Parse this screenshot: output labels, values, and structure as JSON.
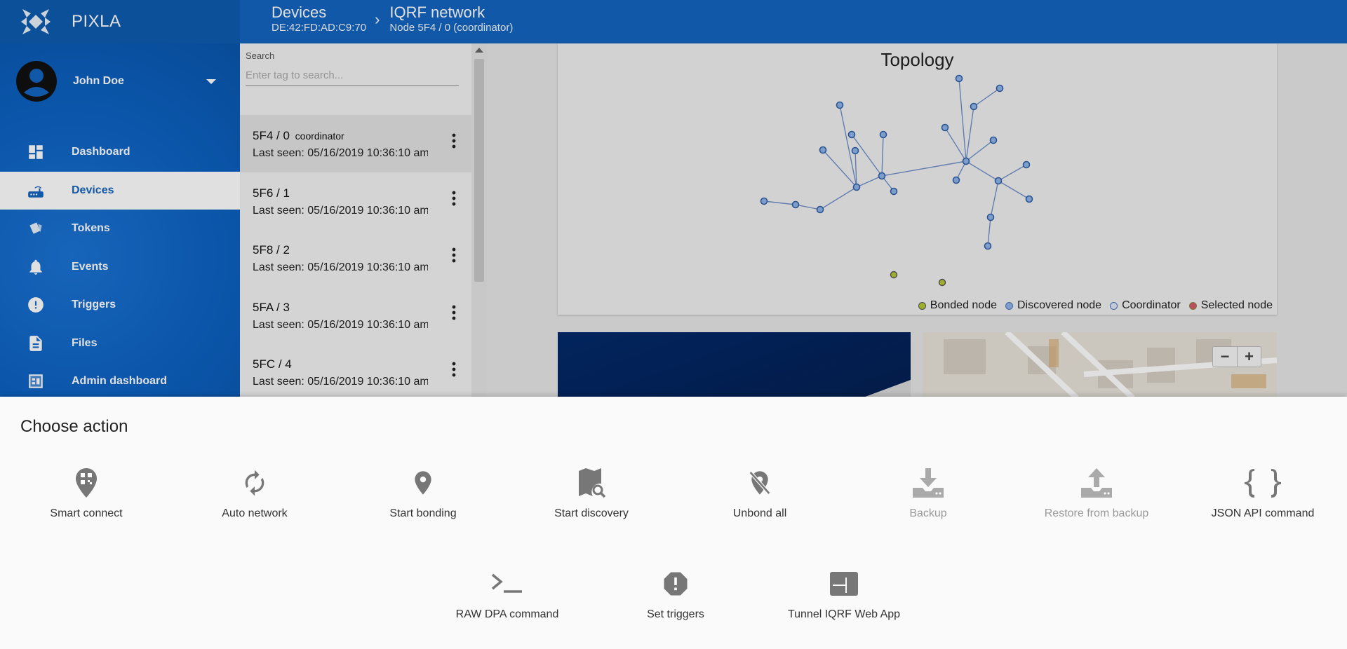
{
  "app": {
    "name": "PIXLA"
  },
  "breadcrumb": [
    {
      "title": "Devices",
      "subtitle": "DE:42:FD:AD:C9:70"
    },
    {
      "title": "IQRF network",
      "subtitle": "Node 5F4 / 0 (coordinator)"
    }
  ],
  "user": {
    "name": "John Doe"
  },
  "nav": [
    {
      "label": "Dashboard",
      "icon": "dashboard-icon"
    },
    {
      "label": "Devices",
      "icon": "router-icon",
      "active": true
    },
    {
      "label": "Tokens",
      "icon": "tokens-icon"
    },
    {
      "label": "Events",
      "icon": "bell-icon"
    },
    {
      "label": "Triggers",
      "icon": "alert-circle-icon"
    },
    {
      "label": "Files",
      "icon": "file-icon"
    },
    {
      "label": "Admin dashboard",
      "icon": "admin-dashboard-icon"
    }
  ],
  "search": {
    "label": "Search",
    "placeholder": "Enter tag to search..."
  },
  "devices": [
    {
      "title": "5F4 / 0",
      "tag": "coordinator",
      "seen": "Last seen: 05/16/2019 10:36:10 am"
    },
    {
      "title": "5F6 / 1",
      "tag": "",
      "seen": "Last seen: 05/16/2019 10:36:10 am"
    },
    {
      "title": "5F8 / 2",
      "tag": "",
      "seen": "Last seen: 05/16/2019 10:36:10 am"
    },
    {
      "title": "5FA / 3",
      "tag": "",
      "seen": "Last seen: 05/16/2019 10:36:10 am"
    },
    {
      "title": "5FC / 4",
      "tag": "",
      "seen": "Last seen: 05/16/2019 10:36:10 am"
    }
  ],
  "topology": {
    "title": "Topology",
    "legend": [
      {
        "label": "Bonded node",
        "color": "#b5c832"
      },
      {
        "label": "Discovered node",
        "color": "#8fb3e6"
      },
      {
        "label": "Coordinator",
        "color": "#dfe8f6"
      },
      {
        "label": "Selected node",
        "color": "#d65a6a"
      }
    ]
  },
  "map": {
    "zoom_out": "−",
    "zoom_in": "+"
  },
  "sheet": {
    "title": "Choose action",
    "actions_row1": [
      {
        "label": "Smart connect",
        "icon": "qr-location-icon",
        "disabled": false
      },
      {
        "label": "Auto network",
        "icon": "autorenew-icon",
        "disabled": false
      },
      {
        "label": "Start bonding",
        "icon": "location-pin-icon",
        "disabled": false
      },
      {
        "label": "Start discovery",
        "icon": "map-search-icon",
        "disabled": false
      },
      {
        "label": "Unbond all",
        "icon": "location-off-icon",
        "disabled": false
      },
      {
        "label": "Backup",
        "icon": "download-icon",
        "disabled": true
      },
      {
        "label": "Restore from backup",
        "icon": "upload-icon",
        "disabled": true
      },
      {
        "label": "JSON API command",
        "icon": "code-braces-icon",
        "disabled": false
      }
    ],
    "actions_row2": [
      {
        "label": "RAW DPA command",
        "icon": "terminal-icon",
        "disabled": false
      },
      {
        "label": "Set triggers",
        "icon": "alert-octagon-icon",
        "disabled": false
      },
      {
        "label": "Tunnel IQRF Web App",
        "icon": "web-app-icon",
        "disabled": false
      }
    ]
  }
}
